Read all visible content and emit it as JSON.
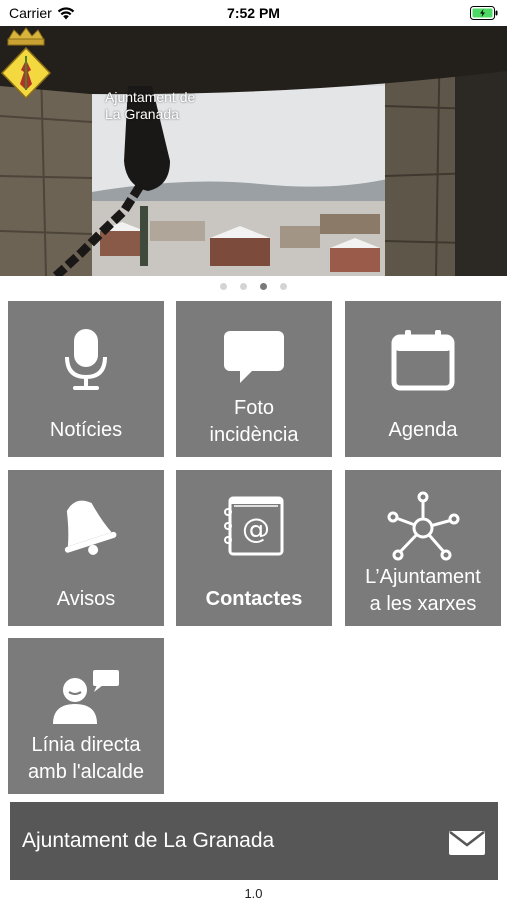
{
  "status_bar": {
    "carrier": "Carrier",
    "time": "7:52 PM"
  },
  "header": {
    "title_line1": "Ajuntament de",
    "title_line2": "La Granada"
  },
  "carousel": {
    "page_count": 4,
    "active_index": 2
  },
  "tiles": [
    {
      "id": "noticies",
      "label": "Notícies",
      "icon": "microphone-icon"
    },
    {
      "id": "foto",
      "label_line1": "Foto",
      "label_line2": "incidència",
      "icon": "speech-bubble-icon"
    },
    {
      "id": "agenda",
      "label": "Agenda",
      "icon": "calendar-icon"
    },
    {
      "id": "avisos",
      "label": "Avisos",
      "icon": "bell-icon"
    },
    {
      "id": "contactes",
      "label": "Contactes",
      "icon": "address-book-icon"
    },
    {
      "id": "xarxes",
      "label_line1": "L’Ajuntament",
      "label_line2": "a les xarxes",
      "icon": "network-icon"
    },
    {
      "id": "linia",
      "label_line1": "Línia directa",
      "label_line2": "amb l'alcalde",
      "icon": "person-chat-icon"
    }
  ],
  "contact_bar": {
    "label": "Ajuntament de La Granada",
    "icon": "mail-icon"
  },
  "footer": {
    "version": "1.0"
  },
  "colors": {
    "tile_bg": "#7b7b7b",
    "contact_bar_bg": "#575757",
    "battery_green": "#4cd964"
  }
}
